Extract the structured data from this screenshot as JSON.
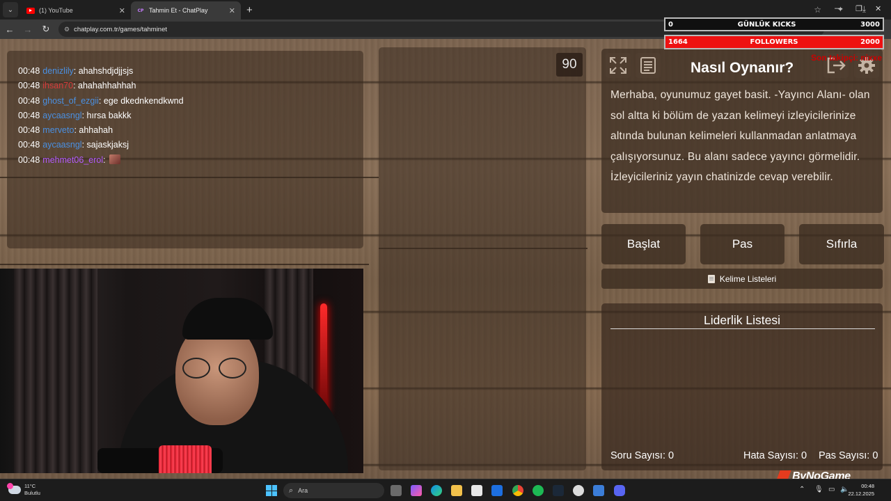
{
  "browser": {
    "tabs": [
      {
        "title": "(1) YouTube",
        "favicon": "youtube-icon"
      },
      {
        "title": "Tahmin Et - ChatPlay",
        "favicon": "chatplay-icon"
      }
    ],
    "url": "chatplay.com.tr/games/tahminet"
  },
  "chat": {
    "lines": [
      {
        "time": "00:48",
        "user": "denizlily",
        "message": "ahahshdjdjjsjs",
        "color": "#4a90e2"
      },
      {
        "time": "00:48",
        "user": "ihsan70",
        "message": "ahahahhahhah",
        "color": "#d63a3a"
      },
      {
        "time": "00:48",
        "user": "ghost_of_ezgii",
        "message": "ege dkednkendkwnd",
        "color": "#4a90e2"
      },
      {
        "time": "00:48",
        "user": "aycaasngl",
        "message": "hırsa bakkk",
        "color": "#4a90e2"
      },
      {
        "time": "00:48",
        "user": "merveto",
        "message": "ahhahah",
        "color": "#4a90e2"
      },
      {
        "time": "00:48",
        "user": "aycaasngl",
        "message": "sajaskjaksj",
        "color": "#4a90e2"
      },
      {
        "time": "00:48",
        "user": "mehmet06_erol",
        "message": "",
        "color": "#b45cff"
      }
    ]
  },
  "game": {
    "timer": "90",
    "how_to_title": "Nasıl Oynanır?",
    "how_to_text": "Merhaba, oyunumuz gayet basit. -Yayıncı Alanı- olan sol altta ki bölüm de yazan kelimeyi izleyicilerinize altında bulunan kelimeleri kullanmadan anlatmaya çalışıyorsunuz. Bu alanı sadece yayıncı görmelidir. İzleyicileriniz yayın chatinizde cevap verebilir.",
    "buttons": {
      "start": "Başlat",
      "pass": "Pas",
      "reset": "Sıfırla"
    },
    "word_lists": "Kelime Listeleri",
    "leaderboard_title": "Liderlik Listesi",
    "stats": {
      "question_label": "Soru Sayısı:",
      "question_count": "0",
      "error_label": "Hata Sayısı:",
      "error_count": "0",
      "pass_label": "Pas Sayısı:",
      "pass_count": "0"
    },
    "icons": [
      "fullscreen-icon",
      "document-icon",
      "logout-icon",
      "gear-icon"
    ]
  },
  "overlay": {
    "kicks": {
      "current": "0",
      "label": "GÜNLÜK KICKS",
      "goal": "3000"
    },
    "followers": {
      "current": "1664",
      "label": "FOLLOWERS",
      "goal": "2000"
    },
    "red_text": "Son takipçi: nixxe",
    "watermark": "ByNoGame"
  },
  "taskbar": {
    "weather_temp": "11°C",
    "weather_desc": "Bulutlu",
    "search_placeholder": "Ara",
    "time": "00:48",
    "date": "22.12.2025"
  },
  "colors": {
    "accent_red": "#ee1111",
    "wood": "#7d6550",
    "user_blue": "#4a90e2",
    "user_purple": "#b45cff"
  }
}
